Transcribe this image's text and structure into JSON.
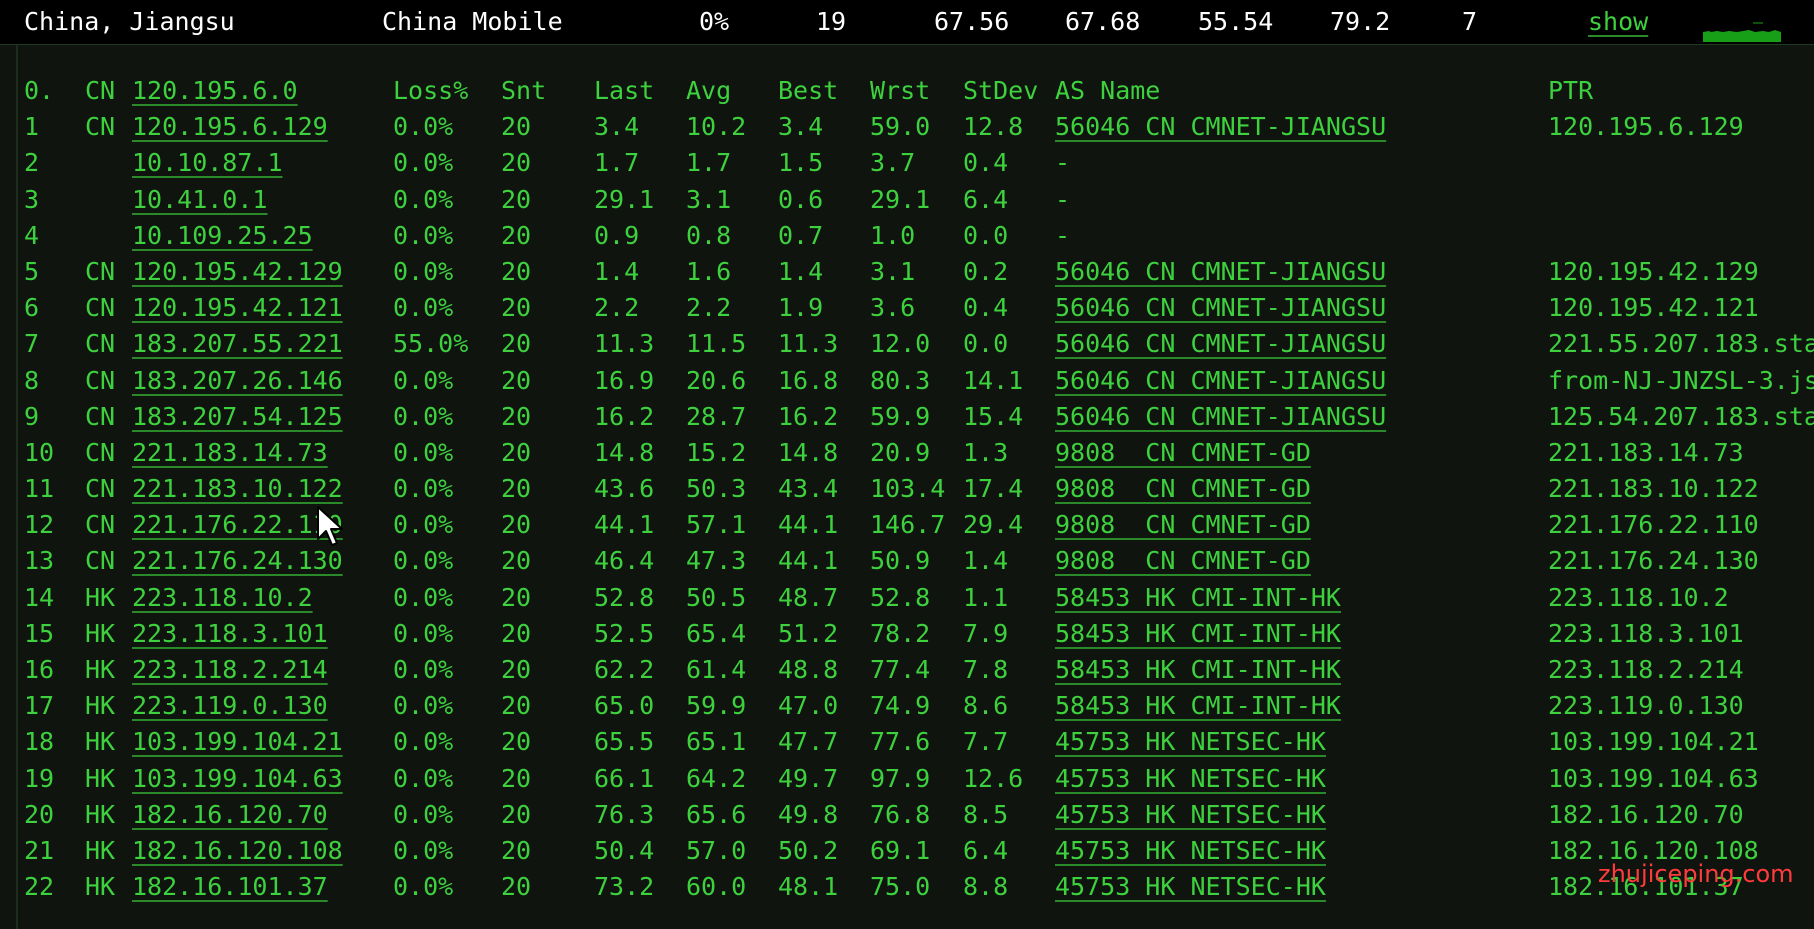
{
  "summary": {
    "location": "China, Jiangsu",
    "isp": "China Mobile",
    "loss": "0%",
    "hops": "19",
    "last": "67.56",
    "avg": "67.68",
    "best": "55.54",
    "worst": "79.2",
    "count": "7",
    "show_label": "show",
    "sparkline_color": "#17a017"
  },
  "header": {
    "idx": "0.",
    "cc": "CN",
    "host": "120.195.6.0",
    "loss": "Loss%",
    "snt": "Snt",
    "last": "Last",
    "avg": "Avg",
    "best": "Best",
    "wrst": "Wrst",
    "stdev": "StDev",
    "as_name": "AS Name",
    "ptr": "PTR"
  },
  "rows": [
    {
      "idx": "1",
      "cc": "CN",
      "host": "120.195.6.129",
      "loss": "0.0%",
      "snt": "20",
      "last": "3.4",
      "avg": "10.2",
      "best": "3.4",
      "wrst": "59.0",
      "stdev": "12.8",
      "as_name": "56046 CN CMNET-JIANGSU",
      "ptr": "120.195.6.129"
    },
    {
      "idx": "2",
      "cc": "",
      "host": "10.10.87.1",
      "loss": "0.0%",
      "snt": "20",
      "last": "1.7",
      "avg": "1.7",
      "best": "1.5",
      "wrst": "3.7",
      "stdev": "0.4",
      "as_name": "-",
      "ptr": ""
    },
    {
      "idx": "3",
      "cc": "",
      "host": "10.41.0.1",
      "loss": "0.0%",
      "snt": "20",
      "last": "29.1",
      "avg": "3.1",
      "best": "0.6",
      "wrst": "29.1",
      "stdev": "6.4",
      "as_name": "-",
      "ptr": ""
    },
    {
      "idx": "4",
      "cc": "",
      "host": "10.109.25.25",
      "loss": "0.0%",
      "snt": "20",
      "last": "0.9",
      "avg": "0.8",
      "best": "0.7",
      "wrst": "1.0",
      "stdev": "0.0",
      "as_name": "-",
      "ptr": ""
    },
    {
      "idx": "5",
      "cc": "CN",
      "host": "120.195.42.129",
      "loss": "0.0%",
      "snt": "20",
      "last": "1.4",
      "avg": "1.6",
      "best": "1.4",
      "wrst": "3.1",
      "stdev": "0.2",
      "as_name": "56046 CN CMNET-JIANGSU",
      "ptr": "120.195.42.129"
    },
    {
      "idx": "6",
      "cc": "CN",
      "host": "120.195.42.121",
      "loss": "0.0%",
      "snt": "20",
      "last": "2.2",
      "avg": "2.2",
      "best": "1.9",
      "wrst": "3.6",
      "stdev": "0.4",
      "as_name": "56046 CN CMNET-JIANGSU",
      "ptr": "120.195.42.121"
    },
    {
      "idx": "7",
      "cc": "CN",
      "host": "183.207.55.221",
      "loss": "55.0%",
      "snt": "20",
      "last": "11.3",
      "avg": "11.5",
      "best": "11.3",
      "wrst": "12.0",
      "stdev": "0.0",
      "as_name": "56046 CN CMNET-JIANGSU",
      "ptr": "221.55.207.183.sta"
    },
    {
      "idx": "8",
      "cc": "CN",
      "host": "183.207.26.146",
      "loss": "0.0%",
      "snt": "20",
      "last": "16.9",
      "avg": "20.6",
      "best": "16.8",
      "wrst": "80.3",
      "stdev": "14.1",
      "as_name": "56046 CN CMNET-JIANGSU",
      "ptr": "from-NJ-JNZSL-3.js"
    },
    {
      "idx": "9",
      "cc": "CN",
      "host": "183.207.54.125",
      "loss": "0.0%",
      "snt": "20",
      "last": "16.2",
      "avg": "28.7",
      "best": "16.2",
      "wrst": "59.9",
      "stdev": "15.4",
      "as_name": "56046 CN CMNET-JIANGSU",
      "ptr": "125.54.207.183.sta"
    },
    {
      "idx": "10",
      "cc": "CN",
      "host": "221.183.14.73",
      "loss": "0.0%",
      "snt": "20",
      "last": "14.8",
      "avg": "15.2",
      "best": "14.8",
      "wrst": "20.9",
      "stdev": "1.3",
      "as_name": "9808  CN CMNET-GD",
      "ptr": "221.183.14.73"
    },
    {
      "idx": "11",
      "cc": "CN",
      "host": "221.183.10.122",
      "loss": "0.0%",
      "snt": "20",
      "last": "43.6",
      "avg": "50.3",
      "best": "43.4",
      "wrst": "103.4",
      "stdev": "17.4",
      "as_name": "9808  CN CMNET-GD",
      "ptr": "221.183.10.122"
    },
    {
      "idx": "12",
      "cc": "CN",
      "host": "221.176.22.110",
      "loss": "0.0%",
      "snt": "20",
      "last": "44.1",
      "avg": "57.1",
      "best": "44.1",
      "wrst": "146.7",
      "stdev": "29.4",
      "as_name": "9808  CN CMNET-GD",
      "ptr": "221.176.22.110"
    },
    {
      "idx": "13",
      "cc": "CN",
      "host": "221.176.24.130",
      "loss": "0.0%",
      "snt": "20",
      "last": "46.4",
      "avg": "47.3",
      "best": "44.1",
      "wrst": "50.9",
      "stdev": "1.4",
      "as_name": "9808  CN CMNET-GD",
      "ptr": "221.176.24.130"
    },
    {
      "idx": "14",
      "cc": "HK",
      "host": "223.118.10.2",
      "loss": "0.0%",
      "snt": "20",
      "last": "52.8",
      "avg": "50.5",
      "best": "48.7",
      "wrst": "52.8",
      "stdev": "1.1",
      "as_name": "58453 HK CMI-INT-HK",
      "ptr": "223.118.10.2"
    },
    {
      "idx": "15",
      "cc": "HK",
      "host": "223.118.3.101",
      "loss": "0.0%",
      "snt": "20",
      "last": "52.5",
      "avg": "65.4",
      "best": "51.2",
      "wrst": "78.2",
      "stdev": "7.9",
      "as_name": "58453 HK CMI-INT-HK",
      "ptr": "223.118.3.101"
    },
    {
      "idx": "16",
      "cc": "HK",
      "host": "223.118.2.214",
      "loss": "0.0%",
      "snt": "20",
      "last": "62.2",
      "avg": "61.4",
      "best": "48.8",
      "wrst": "77.4",
      "stdev": "7.8",
      "as_name": "58453 HK CMI-INT-HK",
      "ptr": "223.118.2.214"
    },
    {
      "idx": "17",
      "cc": "HK",
      "host": "223.119.0.130",
      "loss": "0.0%",
      "snt": "20",
      "last": "65.0",
      "avg": "59.9",
      "best": "47.0",
      "wrst": "74.9",
      "stdev": "8.6",
      "as_name": "58453 HK CMI-INT-HK",
      "ptr": "223.119.0.130"
    },
    {
      "idx": "18",
      "cc": "HK",
      "host": "103.199.104.21",
      "loss": "0.0%",
      "snt": "20",
      "last": "65.5",
      "avg": "65.1",
      "best": "47.7",
      "wrst": "77.6",
      "stdev": "7.7",
      "as_name": "45753 HK NETSEC-HK",
      "ptr": "103.199.104.21"
    },
    {
      "idx": "19",
      "cc": "HK",
      "host": "103.199.104.63",
      "loss": "0.0%",
      "snt": "20",
      "last": "66.1",
      "avg": "64.2",
      "best": "49.7",
      "wrst": "97.9",
      "stdev": "12.6",
      "as_name": "45753 HK NETSEC-HK",
      "ptr": "103.199.104.63"
    },
    {
      "idx": "20",
      "cc": "HK",
      "host": "182.16.120.70",
      "loss": "0.0%",
      "snt": "20",
      "last": "76.3",
      "avg": "65.6",
      "best": "49.8",
      "wrst": "76.8",
      "stdev": "8.5",
      "as_name": "45753 HK NETSEC-HK",
      "ptr": "182.16.120.70"
    },
    {
      "idx": "21",
      "cc": "HK",
      "host": "182.16.120.108",
      "loss": "0.0%",
      "snt": "20",
      "last": "50.4",
      "avg": "57.0",
      "best": "50.2",
      "wrst": "69.1",
      "stdev": "6.4",
      "as_name": "45753 HK NETSEC-HK",
      "ptr": "182.16.120.108"
    },
    {
      "idx": "22",
      "cc": "HK",
      "host": "182.16.101.37",
      "loss": "0.0%",
      "snt": "20",
      "last": "73.2",
      "avg": "60.0",
      "best": "48.1",
      "wrst": "75.0",
      "stdev": "8.8",
      "as_name": "45753 HK NETSEC-HK",
      "ptr": "182.16.101.37"
    }
  ],
  "watermark": "zhujiceping.com",
  "cursor_icon": "mouse-pointer-icon"
}
